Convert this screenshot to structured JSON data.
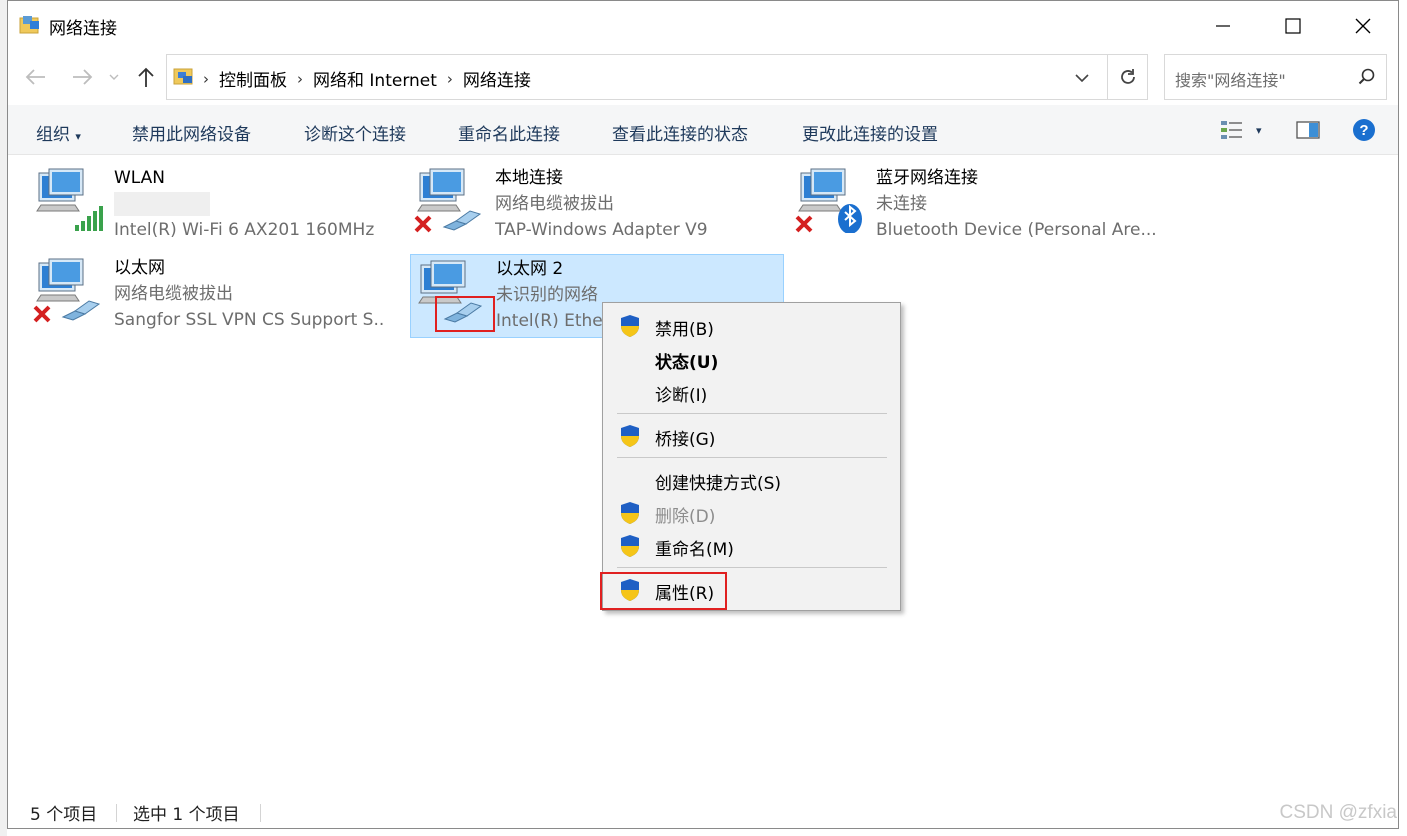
{
  "window": {
    "title": "网络连接"
  },
  "address": {
    "crumbs": [
      "控制面板",
      "网络和 Internet",
      "网络连接"
    ],
    "search_placeholder": "搜索\"网络连接\""
  },
  "toolbar": {
    "organize": "组织",
    "disable_device": "禁用此网络设备",
    "diagnose": "诊断这个连接",
    "rename": "重命名此连接",
    "view_status": "查看此连接的状态",
    "change_settings": "更改此连接的设置"
  },
  "connections": [
    {
      "name": "WLAN",
      "status": "",
      "adapter": "Intel(R) Wi-Fi 6 AX201 160MHz",
      "icon": "wifi-signal-icon"
    },
    {
      "name": "本地连接",
      "status": "网络电缆被拔出",
      "adapter": "TAP-Windows Adapter V9",
      "icon": "ethernet-disconnected-icon"
    },
    {
      "name": "蓝牙网络连接",
      "status": "未连接",
      "adapter": "Bluetooth Device (Personal Are...",
      "icon": "bluetooth-disconnected-icon"
    },
    {
      "name": "以太网",
      "status": "网络电缆被拔出",
      "adapter": "Sangfor SSL VPN CS Support S...",
      "icon": "ethernet-disconnected-icon"
    },
    {
      "name": "以太网 2",
      "status": "未识别的网络",
      "adapter": "Intel(R) Ethe",
      "icon": "ethernet-connected-icon"
    }
  ],
  "context_menu": {
    "items": [
      {
        "label": "禁用(B)",
        "shield": true
      },
      {
        "label": "状态(U)",
        "bold": true
      },
      {
        "label": "诊断(I)"
      },
      {
        "label": "桥接(G)",
        "shield": true
      },
      {
        "label": "创建快捷方式(S)"
      },
      {
        "label": "删除(D)",
        "shield": true,
        "disabled": true
      },
      {
        "label": "重命名(M)",
        "shield": true
      },
      {
        "label": "属性(R)",
        "shield": true
      }
    ]
  },
  "status_bar": {
    "count": "5 个项目",
    "selected": "选中 1 个项目"
  },
  "watermark": "CSDN @zfxia",
  "colors": {
    "selection": "#cce8ff",
    "highlight_border": "#e02020",
    "toolbar_text": "#1e395b"
  }
}
